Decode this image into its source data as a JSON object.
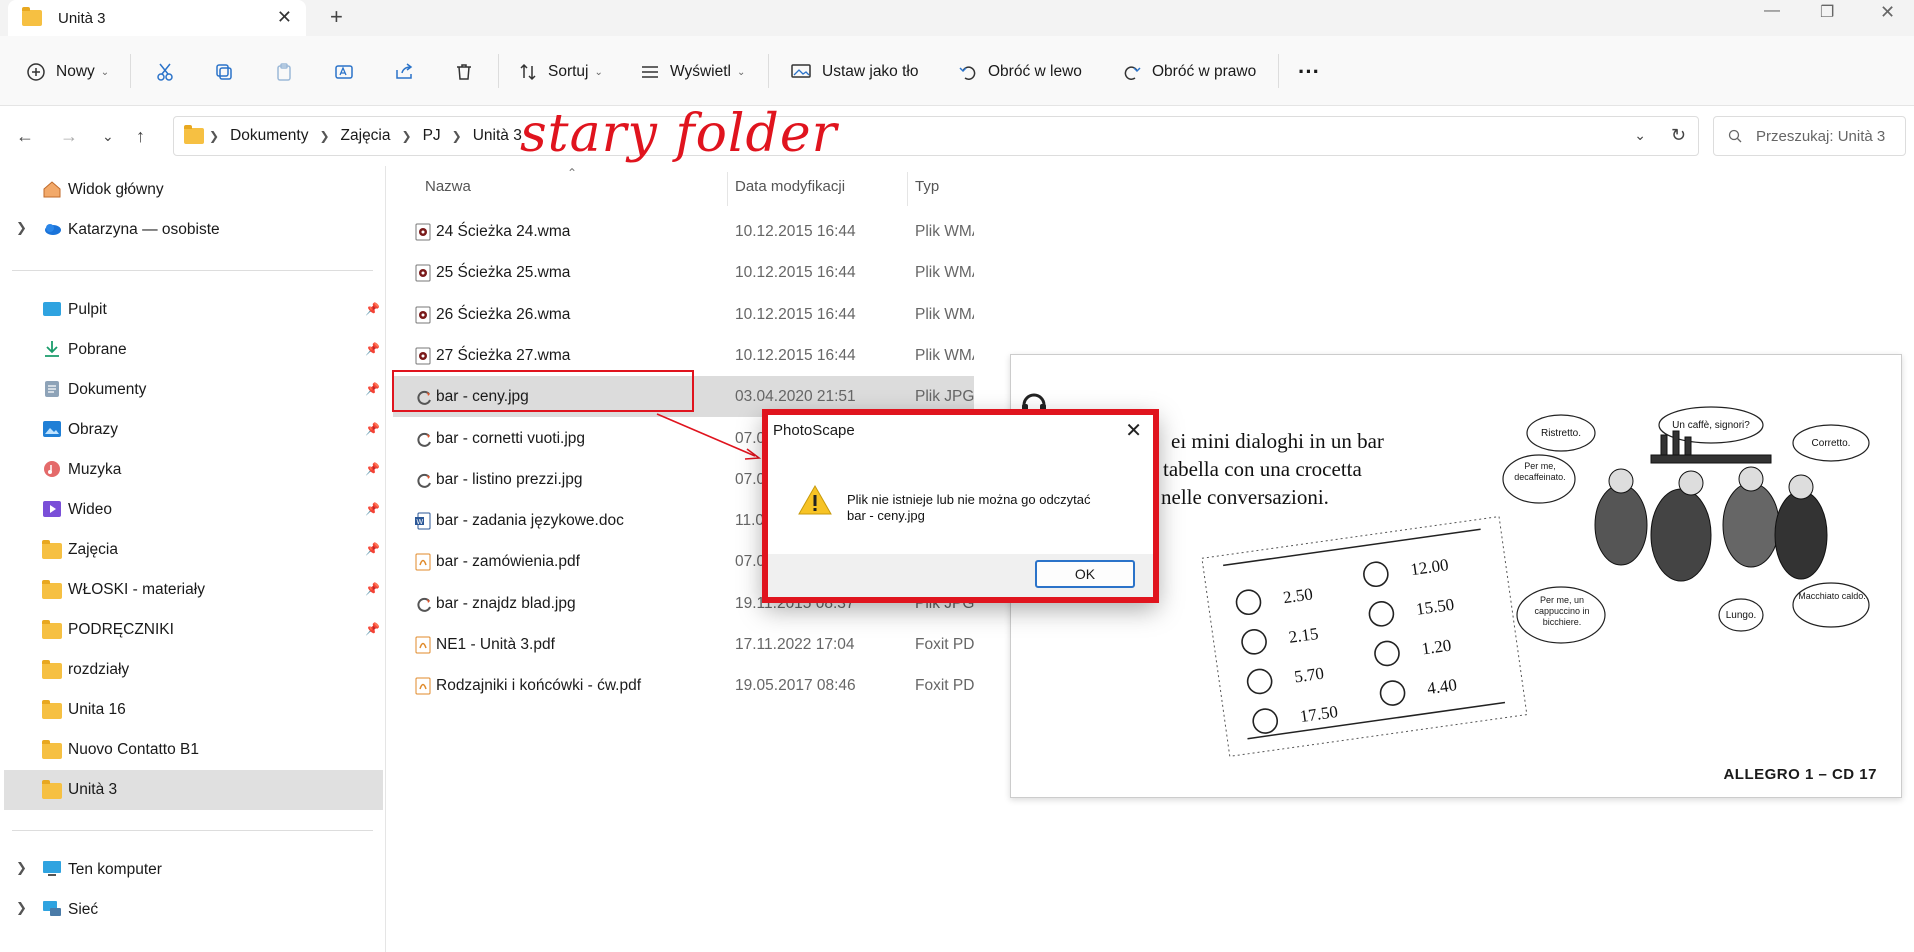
{
  "window": {
    "tab_title": "Unità 3",
    "tab_close": "✕",
    "tab_add": "+"
  },
  "toolbar": {
    "new_label": "Nowy",
    "sort_label": "Sortuj",
    "view_label": "Wyświetl",
    "set_as_wallpaper_label": "Ustaw jako tło",
    "rotate_left_label": "Obróć w lewo",
    "rotate_right_label": "Obróć w prawo",
    "more_label": "···"
  },
  "address": {
    "crumbs": [
      "Dokumenty",
      "Zajęcia",
      "PJ",
      "Unità 3"
    ],
    "search_placeholder": "Przeszukaj: Unità 3"
  },
  "annotation": {
    "text": "stary folder",
    "color": "#e0141e"
  },
  "sidebar": {
    "items": [
      {
        "label": "Widok główny",
        "icon": "home-icon"
      },
      {
        "label": "Katarzyna — osobiste",
        "icon": "cloud-icon"
      },
      {
        "label": "Pulpit",
        "icon": "desktop-icon",
        "pinned": true
      },
      {
        "label": "Pobrane",
        "icon": "download-icon",
        "pinned": true
      },
      {
        "label": "Dokumenty",
        "icon": "documents-icon",
        "pinned": true
      },
      {
        "label": "Obrazy",
        "icon": "pictures-icon",
        "pinned": true
      },
      {
        "label": "Muzyka",
        "icon": "music-icon",
        "pinned": true
      },
      {
        "label": "Wideo",
        "icon": "video-icon",
        "pinned": true
      },
      {
        "label": "Zajęcia",
        "icon": "folder-icon",
        "pinned": true
      },
      {
        "label": "WŁOSKI - materiały",
        "icon": "folder-icon",
        "pinned": true
      },
      {
        "label": "PODRĘCZNIKI",
        "icon": "folder-icon",
        "pinned": true
      },
      {
        "label": "rozdziały",
        "icon": "folder-icon"
      },
      {
        "label": "Unita 16",
        "icon": "folder-icon"
      },
      {
        "label": "Nuovo Contatto B1",
        "icon": "folder-icon"
      },
      {
        "label": "Unità 3",
        "icon": "folder-icon",
        "selected": true
      },
      {
        "label": "Ten komputer",
        "icon": "computer-icon"
      },
      {
        "label": "Sieć",
        "icon": "network-icon"
      }
    ]
  },
  "filelist": {
    "headers": {
      "name": "Nazwa",
      "date": "Data modyfikacji",
      "type": "Typ"
    },
    "rows": [
      {
        "name": "24 Ścieżka 24.wma",
        "date": "10.12.2015 16:44",
        "type": "Plik WMA",
        "icon": "audio-file-icon"
      },
      {
        "name": "25 Ścieżka 25.wma",
        "date": "10.12.2015 16:44",
        "type": "Plik WMA",
        "icon": "audio-file-icon"
      },
      {
        "name": "26 Ścieżka 26.wma",
        "date": "10.12.2015 16:44",
        "type": "Plik WMA",
        "icon": "audio-file-icon"
      },
      {
        "name": "27 Ścieżka 27.wma",
        "date": "10.12.2015 16:44",
        "type": "Plik WMA",
        "icon": "audio-file-icon"
      },
      {
        "name": "bar - ceny.jpg",
        "date": "03.04.2020 21:51",
        "type": "Plik JPG",
        "icon": "image-file-icon",
        "selected": true
      },
      {
        "name": "bar - cornetti vuoti.jpg",
        "date": "07.0",
        "type": "",
        "icon": "image-file-icon"
      },
      {
        "name": "bar - listino prezzi.jpg",
        "date": "07.0",
        "type": "",
        "icon": "image-file-icon"
      },
      {
        "name": "bar - zadania językowe.doc",
        "date": "11.0",
        "type": "",
        "icon": "word-file-icon"
      },
      {
        "name": "bar - zamówienia.pdf",
        "date": "07.0",
        "type": "",
        "icon": "pdf-file-icon"
      },
      {
        "name": "bar - znajdz blad.jpg",
        "date": "19.11.2015 08:37",
        "type": "Plik JPG",
        "icon": "image-file-icon"
      },
      {
        "name": "NE1 - Unità 3.pdf",
        "date": "17.11.2022 17:04",
        "type": "Foxit PDF",
        "icon": "pdf-file-icon"
      },
      {
        "name": "Rodzajniki i końcówki - ćw.pdf",
        "date": "19.05.2017 08:46",
        "type": "Foxit PDF",
        "icon": "pdf-file-icon"
      }
    ]
  },
  "preview": {
    "lines": [
      "ei mini dialoghi in un bar",
      "tabella con una crocetta",
      "nelle conversazioni."
    ],
    "prices_left": [
      "2.50",
      "2.15",
      "5.70",
      "17.50"
    ],
    "prices_right": [
      "12.00",
      "15.50",
      "1.20",
      "4.40"
    ],
    "bubbles": [
      "Ristretto.",
      "Un caffè, signori?",
      "Corretto.",
      "Per me, decaffeinato.",
      "Per me, un cappuccino in bicchiere.",
      "Lungo.",
      "Macchiato caldo."
    ],
    "credit": "ALLEGRO 1 – CD 17"
  },
  "dialog": {
    "title": "PhotoScape",
    "message_line1": "Plik nie istnieje lub nie można go odczytać",
    "message_line2": "bar - ceny.jpg",
    "ok_label": "OK",
    "close": "✕"
  }
}
